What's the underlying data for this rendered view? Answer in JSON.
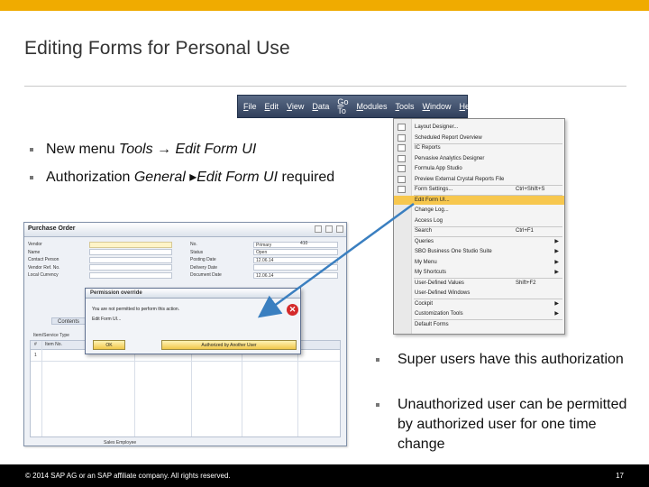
{
  "slide": {
    "title": "Editing Forms for Personal Use",
    "bullets_top": [
      {
        "pre": "New menu ",
        "em1": "Tools",
        "arrow": " → ",
        "em2": "Edit Form UI",
        "post": ""
      },
      {
        "pre": "Authorization ",
        "em1": "General",
        "arrow": " ▸",
        "em2": "Edit Form UI",
        "post": " required"
      }
    ],
    "bullets_right": [
      "Super users have this authorization",
      "Unauthorized user can be permitted by authorized user for one time change"
    ],
    "footer_left": "© 2014 SAP AG or an SAP affiliate company. All rights reserved.",
    "page_number": "17",
    "accent_color": "#f0ab00",
    "arrow_color": "#3a7fc0"
  },
  "menubar": {
    "items": [
      "File",
      "Edit",
      "View",
      "Data",
      "Go To",
      "Modules",
      "Tools",
      "Window",
      "Help"
    ]
  },
  "tools_menu": {
    "items": [
      {
        "label": "Layout Designer...",
        "shortcut": "",
        "submenu": false
      },
      {
        "label": "Scheduled Report Overview",
        "shortcut": "",
        "submenu": false
      },
      {
        "label": "IC Reports",
        "shortcut": "",
        "submenu": false
      },
      {
        "label": "Pervasive Analytics Designer",
        "shortcut": "",
        "submenu": false
      },
      {
        "label": "Formula App Studio",
        "shortcut": "",
        "submenu": false
      },
      {
        "label": "Preview External Crystal Reports File",
        "shortcut": "",
        "submenu": false
      },
      {
        "label": "Form Settings...",
        "shortcut": "Ctrl+Shift+S",
        "submenu": false
      },
      {
        "label": "Edit Form UI...",
        "shortcut": "",
        "submenu": false,
        "highlighted": true
      },
      {
        "label": "Change Log...",
        "shortcut": "",
        "submenu": false
      },
      {
        "label": "Access Log",
        "shortcut": "",
        "submenu": false
      },
      {
        "label": "Search",
        "shortcut": "Ctrl+F1",
        "submenu": false
      },
      {
        "label": "Queries",
        "shortcut": "",
        "submenu": true
      },
      {
        "label": "SBO Business One Studio Suite",
        "shortcut": "",
        "submenu": true
      },
      {
        "label": "My Menu",
        "shortcut": "",
        "submenu": true
      },
      {
        "label": "My Shortcuts",
        "shortcut": "",
        "submenu": true
      },
      {
        "label": "User-Defined Values",
        "shortcut": "Shift+F2",
        "submenu": false
      },
      {
        "label": "User-Defined Windows",
        "shortcut": "",
        "submenu": false
      },
      {
        "label": "Cockpit",
        "shortcut": "",
        "submenu": true
      },
      {
        "label": "Customization Tools",
        "shortcut": "",
        "submenu": true
      },
      {
        "label": "Default Forms",
        "shortcut": "",
        "submenu": false
      }
    ]
  },
  "purchase_order": {
    "title": "Purchase Order",
    "left_labels": [
      "Vendor",
      "Name",
      "Contact Person",
      "Vendor Ref. No.",
      "Local Currency"
    ],
    "right_labels": [
      "No.",
      "Status",
      "Posting Date",
      "Delivery Date",
      "Document Date"
    ],
    "right_values": [
      "Primary",
      "Open",
      "12.06.14",
      "",
      "12.06.14"
    ],
    "doc_number": "410",
    "tab_label": "Contents",
    "item_type_label": "Item/Service Type",
    "col_headers": [
      "#",
      "Item No."
    ],
    "row_number": "1",
    "footer_label": "Sales Employee"
  },
  "dialog": {
    "title": "Permission override",
    "message": "You are not permitted to perform this action.",
    "detail": "Edit Form UI...",
    "ok_label": "OK",
    "auth_label": "Authorized by Another User"
  }
}
